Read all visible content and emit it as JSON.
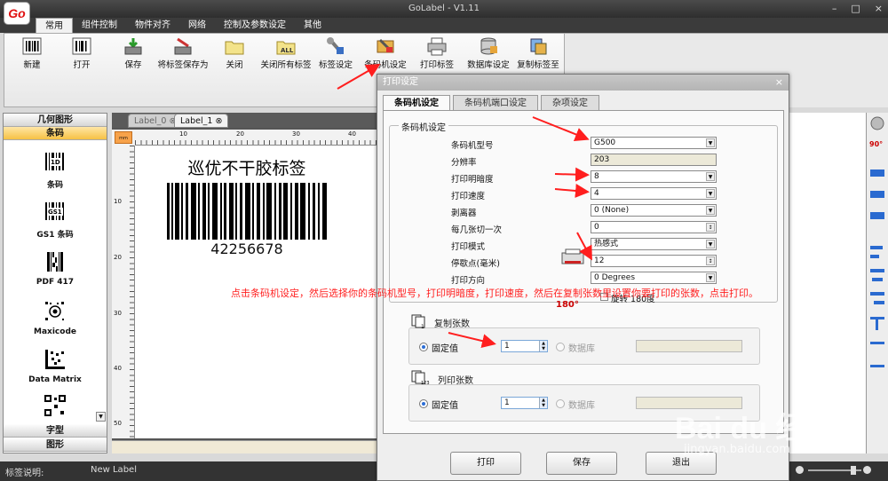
{
  "app": {
    "title": "GoLabel - V1.11",
    "logo": "Go"
  },
  "ribbon_tabs": [
    "常用",
    "组件控制",
    "物件对齐",
    "网络",
    "控制及参数设定",
    "其他"
  ],
  "toolbar": [
    {
      "label": "新建",
      "icon": "barcode-new-icon"
    },
    {
      "label": "打开",
      "icon": "barcode-open-icon"
    },
    {
      "label": "保存",
      "icon": "save-icon"
    },
    {
      "label": "将标签保存为",
      "icon": "save-as-icon"
    },
    {
      "label": "关闭",
      "icon": "folder-close-icon"
    },
    {
      "label": "关闭所有标签",
      "icon": "close-all-icon"
    },
    {
      "label": "标签设定",
      "icon": "label-settings-icon"
    },
    {
      "label": "条码机设定",
      "icon": "printer-settings-icon"
    },
    {
      "label": "打印标签",
      "icon": "print-label-icon"
    },
    {
      "label": "数据库设定",
      "icon": "database-icon"
    },
    {
      "label": "复制标签至",
      "icon": "copy-label-icon"
    }
  ],
  "left_panel": {
    "header_geometry": "几何图形",
    "header_barcode": "条码",
    "items": [
      {
        "label": "条码",
        "icon": "1d-barcode-icon"
      },
      {
        "label": "GS1 条码",
        "icon": "gs1-barcode-icon"
      },
      {
        "label": "PDF 417",
        "icon": "pdf417-icon"
      },
      {
        "label": "Maxicode",
        "icon": "maxicode-icon"
      },
      {
        "label": "Data Matrix",
        "icon": "datamatrix-icon"
      }
    ],
    "footer_font": "字型",
    "footer_graphics": "图形"
  },
  "doc_tabs": [
    "Label_0",
    "Label_1"
  ],
  "ruler": {
    "h_ticks": [
      "10",
      "20",
      "30",
      "40"
    ],
    "v_ticks": [
      "10",
      "20",
      "30",
      "40",
      "50"
    ]
  },
  "label": {
    "title": "巡优不干胶标签",
    "barcode_number": "42256678"
  },
  "status": {
    "label": "标签说明:",
    "value": "New Label"
  },
  "dialog": {
    "title": "打印设定",
    "tabs": [
      "条码机设定",
      "条码机端口设定",
      "杂项设定"
    ],
    "group_title": "条码机设定",
    "fields": [
      {
        "label": "条码机型号",
        "value": "G500",
        "type": "select"
      },
      {
        "label": "分辨率",
        "value": "203",
        "type": "readonly"
      },
      {
        "label": "打印明暗度",
        "value": "8",
        "type": "select"
      },
      {
        "label": "打印速度",
        "value": "4",
        "type": "select"
      },
      {
        "label": "剥离器",
        "value": "0 (None)",
        "type": "select"
      },
      {
        "label": "每几张切一次",
        "value": "0",
        "type": "spin"
      },
      {
        "label": "打印模式",
        "value": "热感式",
        "type": "select"
      },
      {
        "label": "停歇点(毫米)",
        "value": "12",
        "type": "spin"
      },
      {
        "label": "打印方向",
        "value": "0 Degrees",
        "type": "select"
      }
    ],
    "rotate_label": "旋转 180度",
    "rotate_icon_text": "180°",
    "copies": {
      "title": "复制张数",
      "fixed": "固定值",
      "value": "1",
      "database": "数据库"
    },
    "columns": {
      "title": "列印张数",
      "fixed": "固定值",
      "value": "1",
      "database": "数据库"
    },
    "buttons": {
      "print": "打印",
      "save": "保存",
      "exit": "退出"
    }
  },
  "annotation": "点击条码机设定，然后选择你的条码机型号，打印明暗度，打印速度，然后在复制张数里设置你要打印的张数，点击打印。",
  "watermark": {
    "main": "Bai du 经验",
    "sub": "jingyan.baidu.com"
  },
  "colors": {
    "annotation": "#ff2020",
    "arrow": "#ff1e1e",
    "accent_tab": "#f6c143"
  }
}
